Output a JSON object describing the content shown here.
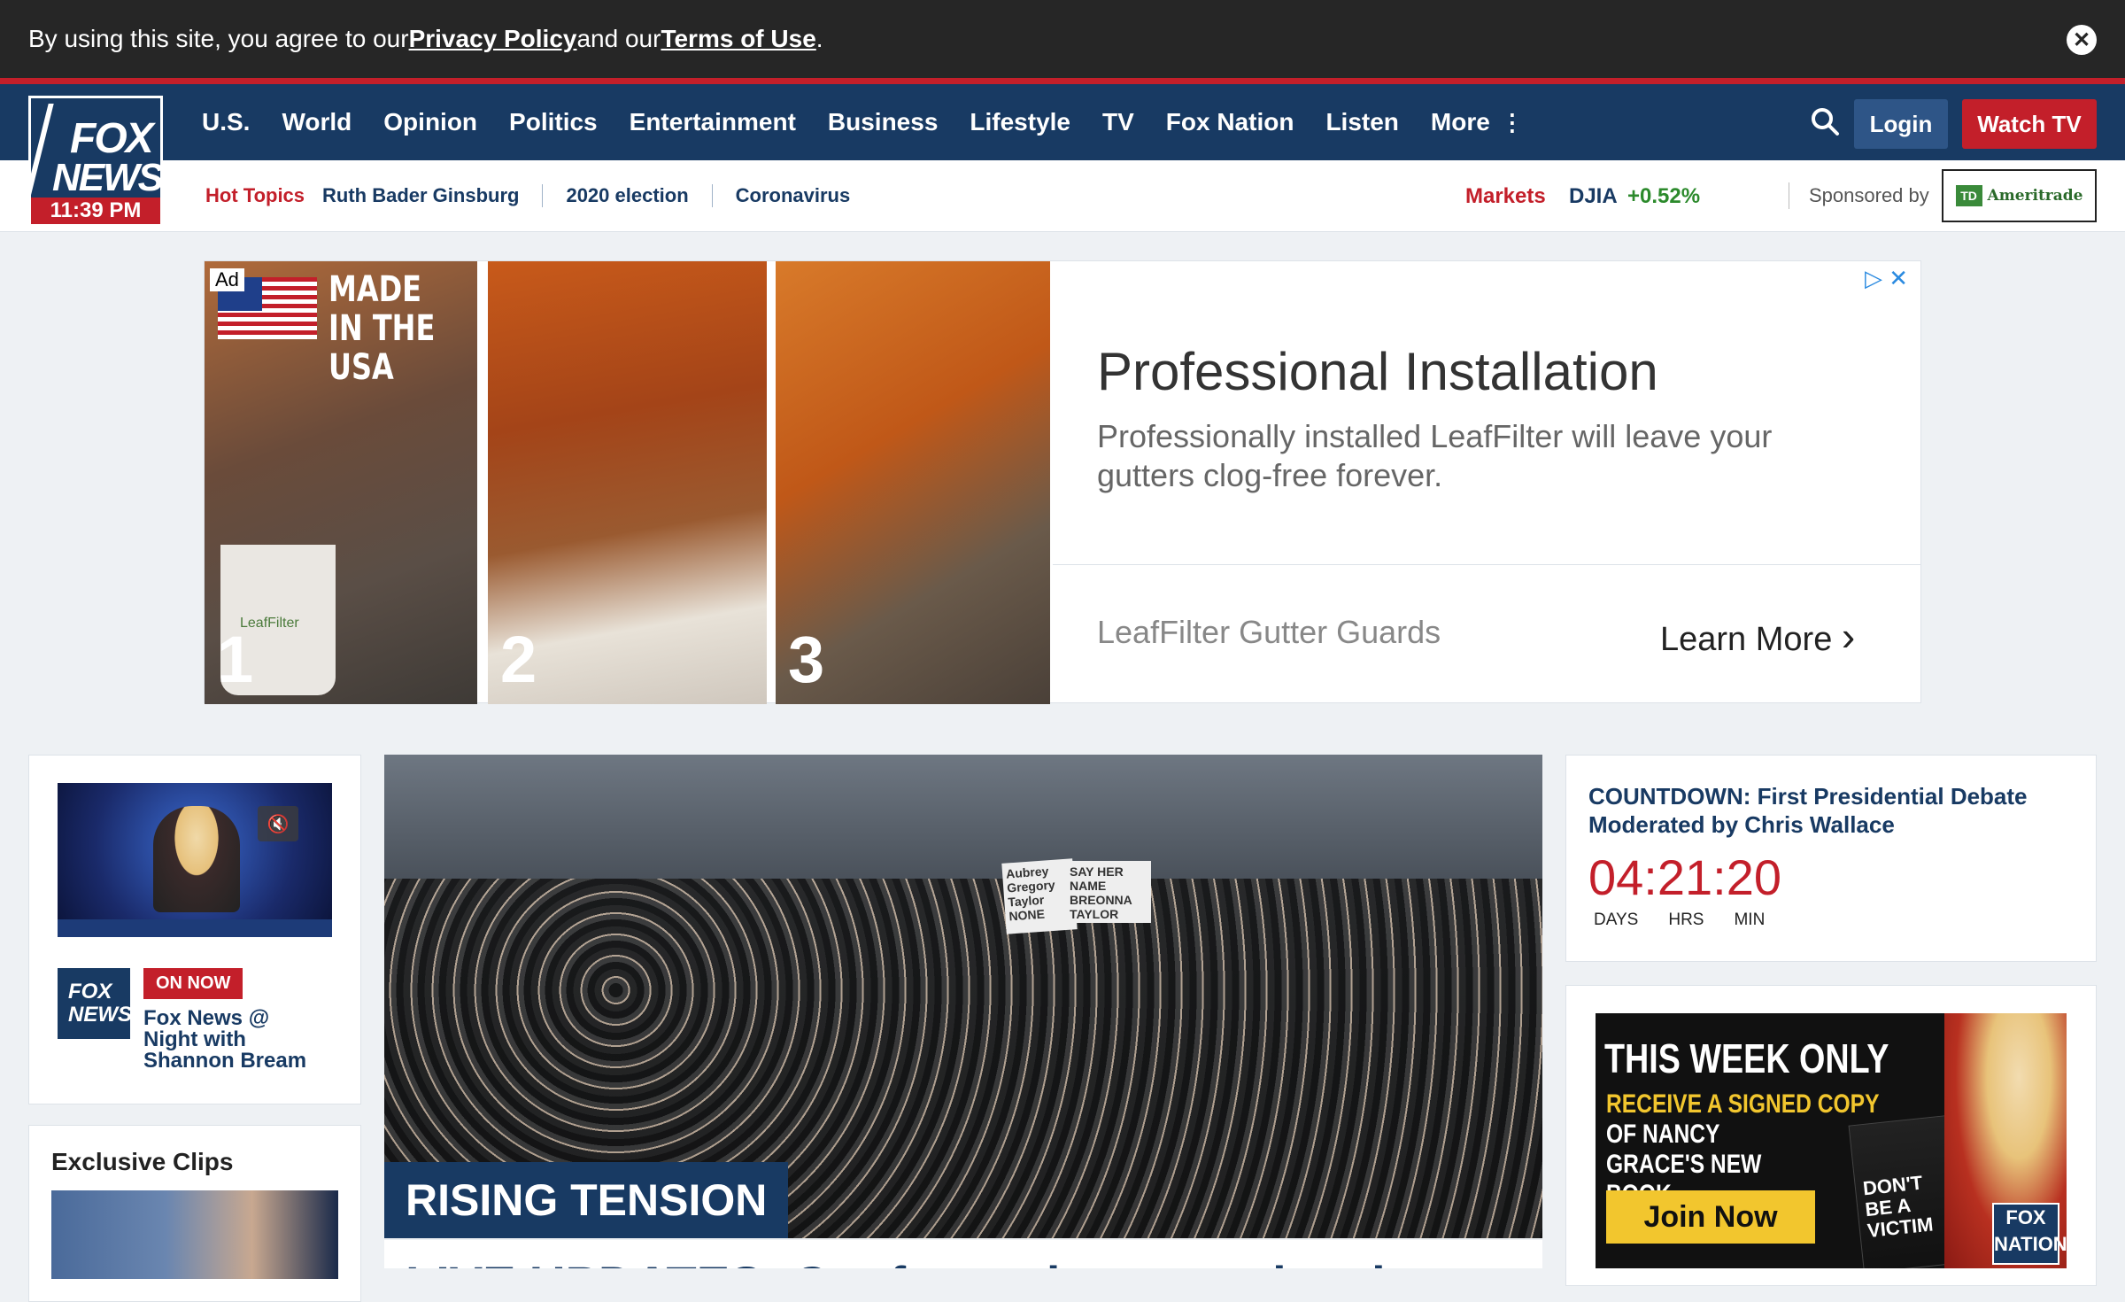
{
  "cookie": {
    "prefix": "By using this site, you agree to our ",
    "privacy": "Privacy Policy",
    "middle": " and our ",
    "terms": "Terms of Use",
    "suffix": ".",
    "close": "✕"
  },
  "logo": {
    "line1": "FOX",
    "line2": "NEWS",
    "time": "11:39 PM"
  },
  "nav": {
    "items": [
      "U.S.",
      "World",
      "Opinion",
      "Politics",
      "Entertainment",
      "Business",
      "Lifestyle",
      "TV",
      "Fox Nation",
      "Listen",
      "More"
    ],
    "more_icon": "⋮",
    "search_icon": "search-icon",
    "login": "Login",
    "watch": "Watch TV"
  },
  "subbar": {
    "hot_label": "Hot Topics",
    "topics": [
      "Ruth Bader Ginsburg",
      "2020 election",
      "Coronavirus"
    ],
    "markets": "Markets",
    "djia": "DJIA",
    "djia_change": "+0.52%",
    "sponsored": "Sponsored by",
    "td": "TD",
    "ameritrade": "Ameritrade"
  },
  "ad": {
    "tag": "Ad",
    "made_in": "MADE IN THE USA",
    "bucket_brand": "LeafFilter",
    "panels": [
      "1",
      "2",
      "3"
    ],
    "headline": "Professional Installation",
    "body": "Professionally installed LeafFilter will leave your gutters clog-free forever.",
    "brand": "LeafFilter Gutter Guards",
    "cta": "Learn More",
    "cta_icon": "›",
    "adchoices": "▷ ✕"
  },
  "left": {
    "mute_icon": "🔇",
    "channel_logo": "FOX NEWS",
    "on_now": "ON NOW",
    "show_title": "Fox News @ Night with Shannon Bream",
    "exclusive_title": "Exclusive Clips"
  },
  "main": {
    "signs": [
      "Aubrey Gregory Taylor NONE",
      "SAY HER NAME BREONNA TAYLOR"
    ],
    "tag": "RISING TENSION",
    "headline": "LIVE UPDATES: Confrontations escalate in Louisville in"
  },
  "right": {
    "countdown_title": "COUNTDOWN: First Presidential Debate Moderated by Chris Wallace",
    "countdown_time": "04:21:20",
    "labels": [
      "DAYS",
      "HRS",
      "MIN"
    ],
    "promo_title": "THIS WEEK ONLY",
    "promo_sub1": "RECEIVE A SIGNED COPY",
    "promo_sub2": "OF NANCY GRACE'S NEW BOOK",
    "promo_join": "Join Now",
    "book_title": "DON'T BE A VICTIM",
    "fox_nation": "FOX NATION"
  }
}
